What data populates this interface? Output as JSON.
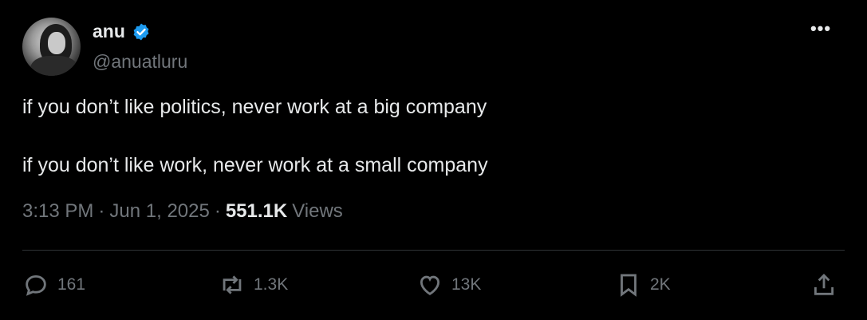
{
  "author": {
    "name": "anu",
    "handle": "@anuatluru",
    "verified_color": "#1d9bf0"
  },
  "more_label": "•••",
  "tweet": {
    "line1": "if you don’t like politics, never work at a big company",
    "line2": "if you don’t like work, never work at a small company"
  },
  "meta": {
    "time": "3:13 PM",
    "sep1": "·",
    "date": "Jun 1, 2025",
    "sep2": "·",
    "views_count": "551.1K",
    "views_label": "Views"
  },
  "actions": {
    "replies": "161",
    "reposts": "1.3K",
    "likes": "13K",
    "bookmarks": "2K"
  },
  "icons": {
    "reply": "reply-icon",
    "repost": "repost-icon",
    "like": "heart-icon",
    "bookmark": "bookmark-icon",
    "share": "share-icon"
  }
}
